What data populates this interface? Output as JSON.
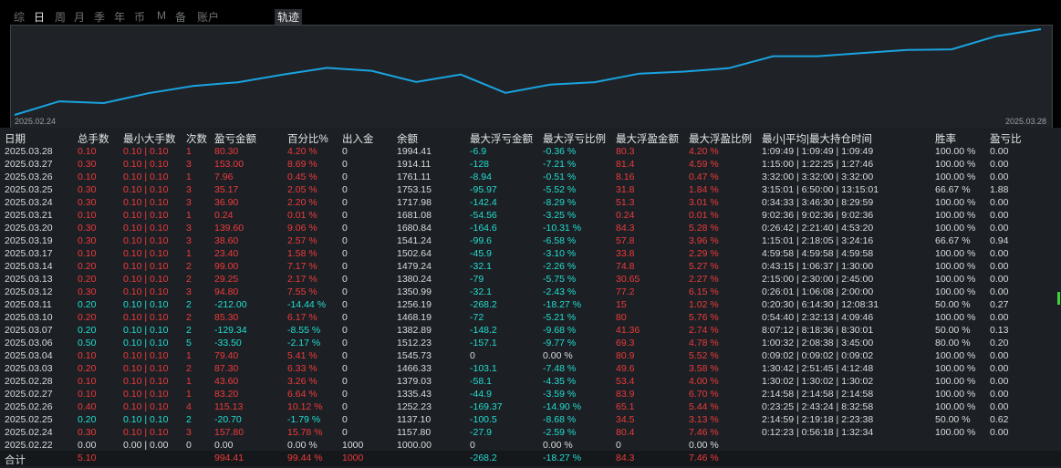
{
  "tabs": [
    "综",
    "日",
    "周",
    "月",
    "季",
    "年",
    "币",
    "M",
    "备",
    "账户",
    "轨迹"
  ],
  "chart": {
    "start_label": "2025.02.24",
    "end_label": "2025.03.28",
    "line_color": "#1aa3e0",
    "balances": [
      1000.0,
      1157.8,
      1137.1,
      1252.23,
      1335.43,
      1379.03,
      1466.33,
      1545.73,
      1512.23,
      1382.89,
      1468.19,
      1256.19,
      1350.99,
      1380.24,
      1479.24,
      1502.64,
      1541.24,
      1680.84,
      1681.08,
      1717.98,
      1753.15,
      1761.11,
      1914.11,
      1994.41
    ]
  },
  "headers": [
    "日期",
    "总手数",
    "最小大手数",
    "次数",
    "盈亏金额",
    "百分比%",
    "出入金",
    "余额",
    "最大浮亏金额",
    "最大浮亏比例",
    "最大浮盈金额",
    "最大浮盈比例",
    "最小|平均|最大持仓时间",
    "胜率",
    "盈亏比"
  ],
  "rows": [
    [
      "2025.03.28",
      "0.10",
      "0.10 | 0.10",
      "1",
      "80.30",
      "4.20 %",
      "0",
      "1994.41",
      "-6.9",
      "-0.36 %",
      "80.3",
      "4.20 %",
      "1:09:49 | 1:09:49 | 1:09:49",
      "100.00 %",
      "0.00"
    ],
    [
      "2025.03.27",
      "0.30",
      "0.10 | 0.10",
      "3",
      "153.00",
      "8.69 %",
      "0",
      "1914.11",
      "-128",
      "-7.21 %",
      "81.4",
      "4.59 %",
      "1:15:00 | 1:22:25 | 1:27:46",
      "100.00 %",
      "0.00"
    ],
    [
      "2025.03.26",
      "0.10",
      "0.10 | 0.10",
      "1",
      "7.96",
      "0.45 %",
      "0",
      "1761.11",
      "-8.94",
      "-0.51 %",
      "8.16",
      "0.47 %",
      "3:32:00 | 3:32:00 | 3:32:00",
      "100.00 %",
      "0.00"
    ],
    [
      "2025.03.25",
      "0.30",
      "0.10 | 0.10",
      "3",
      "35.17",
      "2.05 %",
      "0",
      "1753.15",
      "-95.97",
      "-5.52 %",
      "31.8",
      "1.84 %",
      "3:15:01 | 6:50:00 | 13:15:01",
      "66.67 %",
      "1.88"
    ],
    [
      "2025.03.24",
      "0.30",
      "0.10 | 0.10",
      "3",
      "36.90",
      "2.20 %",
      "0",
      "1717.98",
      "-142.4",
      "-8.29 %",
      "51.3",
      "3.01 %",
      "0:34:33 | 3:46:30 | 8:29:59",
      "100.00 %",
      "0.00"
    ],
    [
      "2025.03.21",
      "0.10",
      "0.10 | 0.10",
      "1",
      "0.24",
      "0.01 %",
      "0",
      "1681.08",
      "-54.56",
      "-3.25 %",
      "0.24",
      "0.01 %",
      "9:02:36 | 9:02:36 | 9:02:36",
      "100.00 %",
      "0.00"
    ],
    [
      "2025.03.20",
      "0.30",
      "0.10 | 0.10",
      "3",
      "139.60",
      "9.06 %",
      "0",
      "1680.84",
      "-164.6",
      "-10.31 %",
      "84.3",
      "5.28 %",
      "0:26:42 | 2:21:40 | 4:53:20",
      "100.00 %",
      "0.00"
    ],
    [
      "2025.03.19",
      "0.30",
      "0.10 | 0.10",
      "3",
      "38.60",
      "2.57 %",
      "0",
      "1541.24",
      "-99.6",
      "-6.58 %",
      "57.8",
      "3.96 %",
      "1:15:01 | 2:18:05 | 3:24:16",
      "66.67 %",
      "0.94"
    ],
    [
      "2025.03.17",
      "0.10",
      "0.10 | 0.10",
      "1",
      "23.40",
      "1.58 %",
      "0",
      "1502.64",
      "-45.9",
      "-3.10 %",
      "33.8",
      "2.29 %",
      "4:59:58 | 4:59:58 | 4:59:58",
      "100.00 %",
      "0.00"
    ],
    [
      "2025.03.14",
      "0.20",
      "0.10 | 0.10",
      "2",
      "99.00",
      "7.17 %",
      "0",
      "1479.24",
      "-32.1",
      "-2.26 %",
      "74.8",
      "5.27 %",
      "0:43:15 | 1:06:37 | 1:30:00",
      "100.00 %",
      "0.00"
    ],
    [
      "2025.03.13",
      "0.20",
      "0.10 | 0.10",
      "2",
      "29.25",
      "2.17 %",
      "0",
      "1380.24",
      "-79",
      "-5.75 %",
      "30.65",
      "2.27 %",
      "2:15:00 | 2:30:00 | 2:45:00",
      "100.00 %",
      "0.00"
    ],
    [
      "2025.03.12",
      "0.30",
      "0.10 | 0.10",
      "3",
      "94.80",
      "7.55 %",
      "0",
      "1350.99",
      "-32.1",
      "-2.43 %",
      "77.2",
      "6.15 %",
      "0:26:01 | 1:06:08 | 2:00:00",
      "100.00 %",
      "0.00"
    ],
    [
      "2025.03.11",
      "0.20",
      "0.10 | 0.10",
      "2",
      "-212.00",
      "-14.44 %",
      "0",
      "1256.19",
      "-268.2",
      "-18.27 %",
      "15",
      "1.02 %",
      "0:20:30 | 6:14:30 | 12:08:31",
      "50.00 %",
      "0.27"
    ],
    [
      "2025.03.10",
      "0.20",
      "0.10 | 0.10",
      "2",
      "85.30",
      "6.17 %",
      "0",
      "1468.19",
      "-72",
      "-5.21 %",
      "80",
      "5.76 %",
      "0:54:40 | 2:32:13 | 4:09:46",
      "100.00 %",
      "0.00"
    ],
    [
      "2025.03.07",
      "0.20",
      "0.10 | 0.10",
      "2",
      "-129.34",
      "-8.55 %",
      "0",
      "1382.89",
      "-148.2",
      "-9.68 %",
      "41.36",
      "2.74 %",
      "8:07:12 | 8:18:36 | 8:30:01",
      "50.00 %",
      "0.13"
    ],
    [
      "2025.03.06",
      "0.50",
      "0.10 | 0.10",
      "5",
      "-33.50",
      "-2.17 %",
      "0",
      "1512.23",
      "-157.1",
      "-9.77 %",
      "69.3",
      "4.78 %",
      "1:00:32 | 2:08:38 | 3:45:00",
      "80.00 %",
      "0.20"
    ],
    [
      "2025.03.04",
      "0.10",
      "0.10 | 0.10",
      "1",
      "79.40",
      "5.41 %",
      "0",
      "1545.73",
      "0",
      "0.00 %",
      "80.9",
      "5.52 %",
      "0:09:02 | 0:09:02 | 0:09:02",
      "100.00 %",
      "0.00"
    ],
    [
      "2025.03.03",
      "0.20",
      "0.10 | 0.10",
      "2",
      "87.30",
      "6.33 %",
      "0",
      "1466.33",
      "-103.1",
      "-7.48 %",
      "49.6",
      "3.58 %",
      "1:30:42 | 2:51:45 | 4:12:48",
      "100.00 %",
      "0.00"
    ],
    [
      "2025.02.28",
      "0.10",
      "0.10 | 0.10",
      "1",
      "43.60",
      "3.26 %",
      "0",
      "1379.03",
      "-58.1",
      "-4.35 %",
      "53.4",
      "4.00 %",
      "1:30:02 | 1:30:02 | 1:30:02",
      "100.00 %",
      "0.00"
    ],
    [
      "2025.02.27",
      "0.10",
      "0.10 | 0.10",
      "1",
      "83.20",
      "6.64 %",
      "0",
      "1335.43",
      "-44.9",
      "-3.59 %",
      "83.9",
      "6.70 %",
      "2:14:58 | 2:14:58 | 2:14:58",
      "100.00 %",
      "0.00"
    ],
    [
      "2025.02.26",
      "0.40",
      "0.10 | 0.10",
      "4",
      "115.13",
      "10.12 %",
      "0",
      "1252.23",
      "-169.37",
      "-14.90 %",
      "65.1",
      "5.44 %",
      "0:23:25 | 2:43:24 | 8:32:58",
      "100.00 %",
      "0.00"
    ],
    [
      "2025.02.25",
      "0.20",
      "0.10 | 0.10",
      "2",
      "-20.70",
      "-1.79 %",
      "0",
      "1137.10",
      "-100.5",
      "-8.68 %",
      "34.5",
      "3.13 %",
      "2:14:59 | 2:19:18 | 2:23:38",
      "50.00 %",
      "0.62"
    ],
    [
      "2025.02.24",
      "0.30",
      "0.10 | 0.10",
      "3",
      "157.80",
      "15.78 %",
      "0",
      "1157.80",
      "-27.9",
      "-2.59 %",
      "80.4",
      "7.46 %",
      "0:12:23 | 0:56:18 | 1:32:34",
      "100.00 %",
      "0.00"
    ],
    [
      "2025.02.22",
      "0.00",
      "0.00 | 0.00",
      "0",
      "0.00",
      "0.00 %",
      "1000",
      "1000.00",
      "0",
      "0.00 %",
      "0",
      "0.00 %",
      "",
      "",
      ""
    ]
  ],
  "total": {
    "label": "合计",
    "lots": "5.10",
    "pnl": "994.41",
    "pct": "99.44 %",
    "deposit": "1000",
    "max_float_loss": "-268.2",
    "max_float_loss_pct": "-18.27 %",
    "max_float_profit": "84.3",
    "max_float_profit_pct": "7.46 %"
  },
  "colors": {
    "profit": "#ee3a3a",
    "loss": "#22ddd0",
    "neutral": "#d9dcde"
  }
}
